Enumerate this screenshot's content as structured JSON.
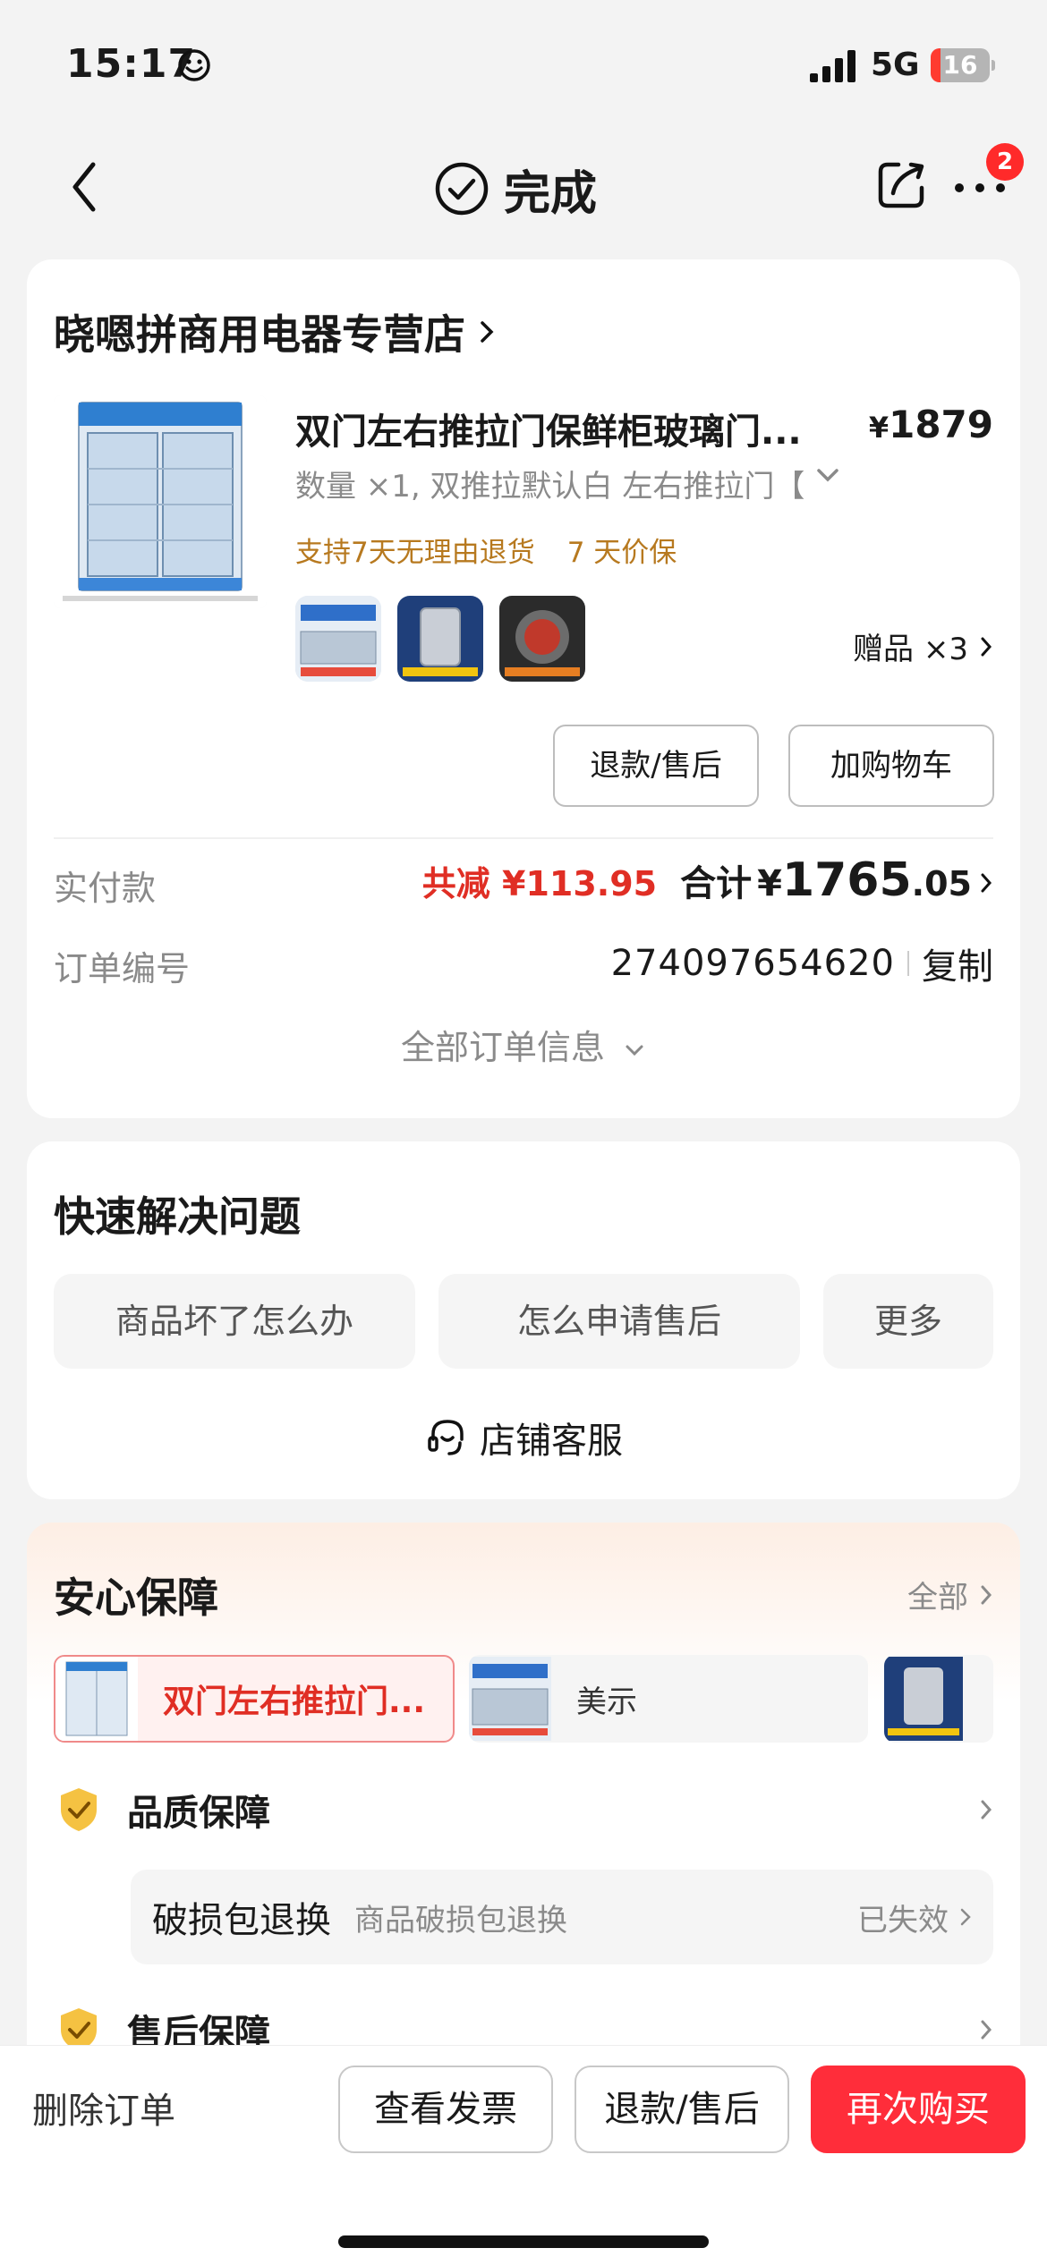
{
  "status_bar": {
    "time": "15:17",
    "network": "5G",
    "battery": "16",
    "battery_level": 0.16
  },
  "nav": {
    "title": "完成",
    "badge": "2"
  },
  "order": {
    "shop_name": "晓嗯拼商用电器专营店",
    "product_title": "双门左右推拉门保鲜柜玻璃门...",
    "price_symbol": "¥",
    "price_value": "1879",
    "spec": "数量 ×1, 双推拉默认白 左右推拉门【",
    "promises": [
      "支持7天无理由退货",
      "7 天价保"
    ],
    "gift_label": "赠品 ×3",
    "refund_button": "退款/售后",
    "cart_button": "加购物车",
    "paid_label": "实付款",
    "discount": "共减 ¥113.95",
    "total_label": "合计",
    "total_yen": "¥",
    "total_int": "1765",
    "total_dec": ".05",
    "order_no_label": "订单编号",
    "order_no": "274097654620",
    "copy_label": "复制",
    "all_info": "全部订单信息"
  },
  "quick": {
    "title": "快速解决问题",
    "buttons": [
      "商品坏了怎么办",
      "怎么申请售后",
      "更多"
    ],
    "service": "店铺客服"
  },
  "guarantee": {
    "title": "安心保障",
    "all": "全部",
    "tabs": [
      "双门左右推拉门...",
      "美示"
    ],
    "rows": [
      {
        "title": "品质保障",
        "item": {
          "name": "破损包退换",
          "desc": "商品破损包退换",
          "status": "已失效"
        }
      },
      {
        "title": "售后保障"
      }
    ]
  },
  "bottom": {
    "delete": "删除订单",
    "invoice": "查看发票",
    "refund": "退款/售后",
    "rebuy": "再次购买"
  },
  "colors": {
    "accent_red": "#ff2d3a",
    "discount_red": "#e02e24",
    "promise_gold": "#b7791f",
    "shield_gold": "#f5c242"
  }
}
